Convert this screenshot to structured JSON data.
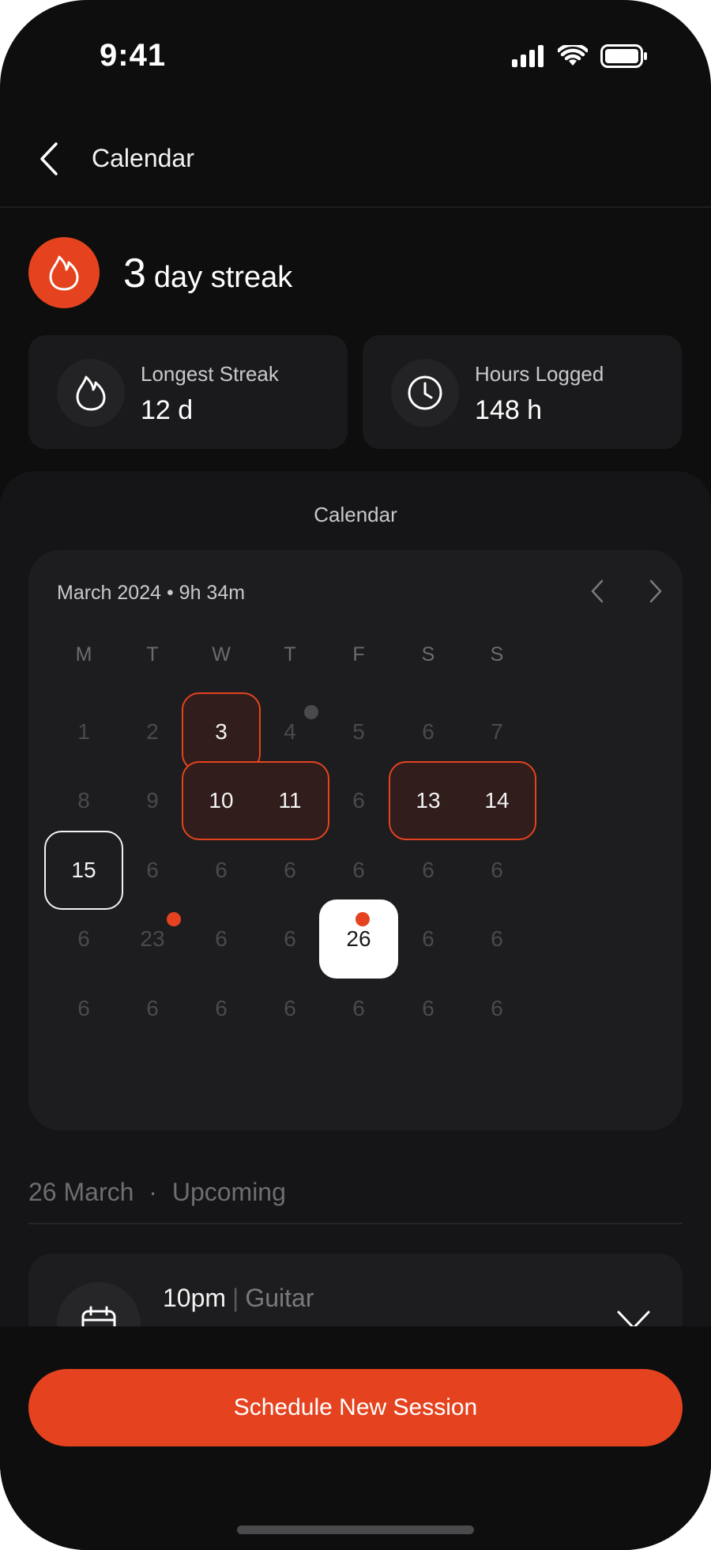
{
  "status_bar": {
    "time": "9:41"
  },
  "header": {
    "title": "Calendar"
  },
  "streak": {
    "count": "3",
    "label": "day streak"
  },
  "stats": [
    {
      "label": "Longest Streak",
      "value": "12 d",
      "icon": "flame-icon"
    },
    {
      "label": "Hours Logged",
      "value": "148 h",
      "icon": "clock-icon"
    }
  ],
  "calendar": {
    "section_title": "Calendar",
    "month_summary": "March 2024 • 9h 34m",
    "weekdays": [
      "M",
      "T",
      "W",
      "T",
      "F",
      "S",
      "S"
    ],
    "weeks": [
      [
        "1",
        "2",
        "3",
        "4",
        "5",
        "6",
        "7"
      ],
      [
        "8",
        "9",
        "10",
        "11",
        "6",
        "13",
        "14"
      ],
      [
        "15",
        "6",
        "6",
        "6",
        "6",
        "6",
        "6"
      ],
      [
        "6",
        "23",
        "6",
        "6",
        "26",
        "6",
        "6"
      ],
      [
        "6",
        "6",
        "6",
        "6",
        "6",
        "6",
        "6"
      ]
    ],
    "logged_days": [
      "3",
      "10",
      "11",
      "13",
      "14"
    ],
    "today": "15",
    "selected": "26",
    "accent_color": "#e5431f"
  },
  "upcoming": {
    "date": "26 March",
    "label": "Upcoming",
    "sessions": [
      {
        "time": "10pm",
        "name": "Guitar"
      }
    ]
  },
  "cta": {
    "label": "Schedule New Session"
  }
}
